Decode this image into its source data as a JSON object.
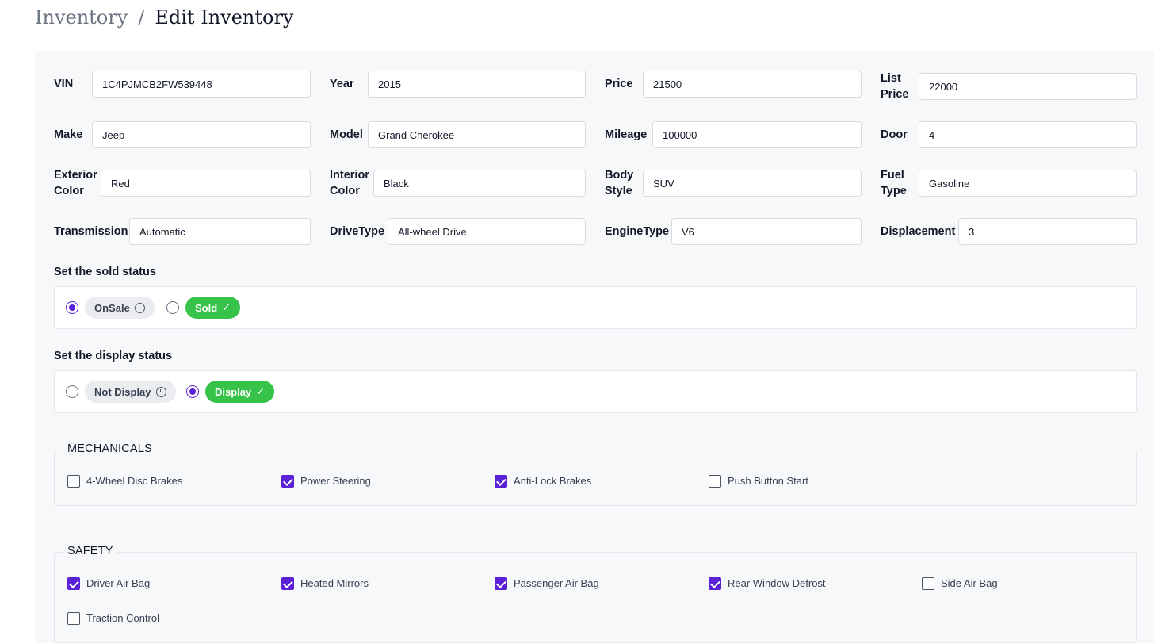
{
  "breadcrumb": {
    "parent": "Inventory",
    "separator": "/",
    "current": "Edit Inventory"
  },
  "fields": {
    "vin": {
      "label": "VIN",
      "value": "1C4PJMCB2FW539448"
    },
    "year": {
      "label": "Year",
      "value": "2015"
    },
    "price": {
      "label": "Price",
      "value": "21500"
    },
    "list_price": {
      "label_line1": "List",
      "label_line2": "Price",
      "value": "22000"
    },
    "make": {
      "label": "Make",
      "value": "Jeep"
    },
    "model": {
      "label": "Model",
      "value": "Grand Cherokee"
    },
    "mileage": {
      "label": "Mileage",
      "value": "100000"
    },
    "door": {
      "label": "Door",
      "value": "4"
    },
    "exterior_color": {
      "label_line1": "Exterior",
      "label_line2": "Color",
      "value": "Red"
    },
    "interior_color": {
      "label_line1": "Interior",
      "label_line2": "Color",
      "value": "Black"
    },
    "body_style": {
      "label_line1": "Body",
      "label_line2": "Style",
      "value": "SUV"
    },
    "fuel_type": {
      "label_line1": "Fuel",
      "label_line2": "Type",
      "value": "Gasoline"
    },
    "transmission": {
      "label": "Transmission",
      "value": "Automatic"
    },
    "drive_type": {
      "label": "DriveType",
      "value": "All-wheel Drive"
    },
    "engine_type": {
      "label": "EngineType",
      "value": "V6"
    },
    "displacement": {
      "label": "Displacement",
      "value": "3"
    }
  },
  "sold_status": {
    "heading": "Set the sold status",
    "options": [
      {
        "label": "OnSale",
        "selected": true,
        "icon": "clock-icon",
        "color": "#ebecef"
      },
      {
        "label": "Sold",
        "selected": false,
        "icon": "check-icon",
        "color": "#37c24a"
      }
    ]
  },
  "display_status": {
    "heading": "Set the display status",
    "options": [
      {
        "label": "Not Display",
        "selected": false,
        "icon": "clock-icon",
        "color": "#ebecef"
      },
      {
        "label": "Display",
        "selected": true,
        "icon": "check-icon",
        "color": "#37c24a"
      }
    ]
  },
  "mechanicals": {
    "legend": "MECHANICALS",
    "items": [
      {
        "label": "4-Wheel Disc Brakes",
        "checked": false
      },
      {
        "label": "Power Steering",
        "checked": true
      },
      {
        "label": "Anti-Lock Brakes",
        "checked": true
      },
      {
        "label": "Push Button Start",
        "checked": false
      }
    ]
  },
  "safety": {
    "legend": "SAFETY",
    "items": [
      {
        "label": "Driver Air Bag",
        "checked": true
      },
      {
        "label": "Heated Mirrors",
        "checked": true
      },
      {
        "label": "Passenger Air Bag",
        "checked": true
      },
      {
        "label": "Rear Window Defrost",
        "checked": true
      },
      {
        "label": "Side Air Bag",
        "checked": false
      },
      {
        "label": "Traction Control",
        "checked": false
      }
    ]
  },
  "colors": {
    "accent": "#5b21d6",
    "success": "#37c24a",
    "panel_bg": "#f7f8fa"
  }
}
